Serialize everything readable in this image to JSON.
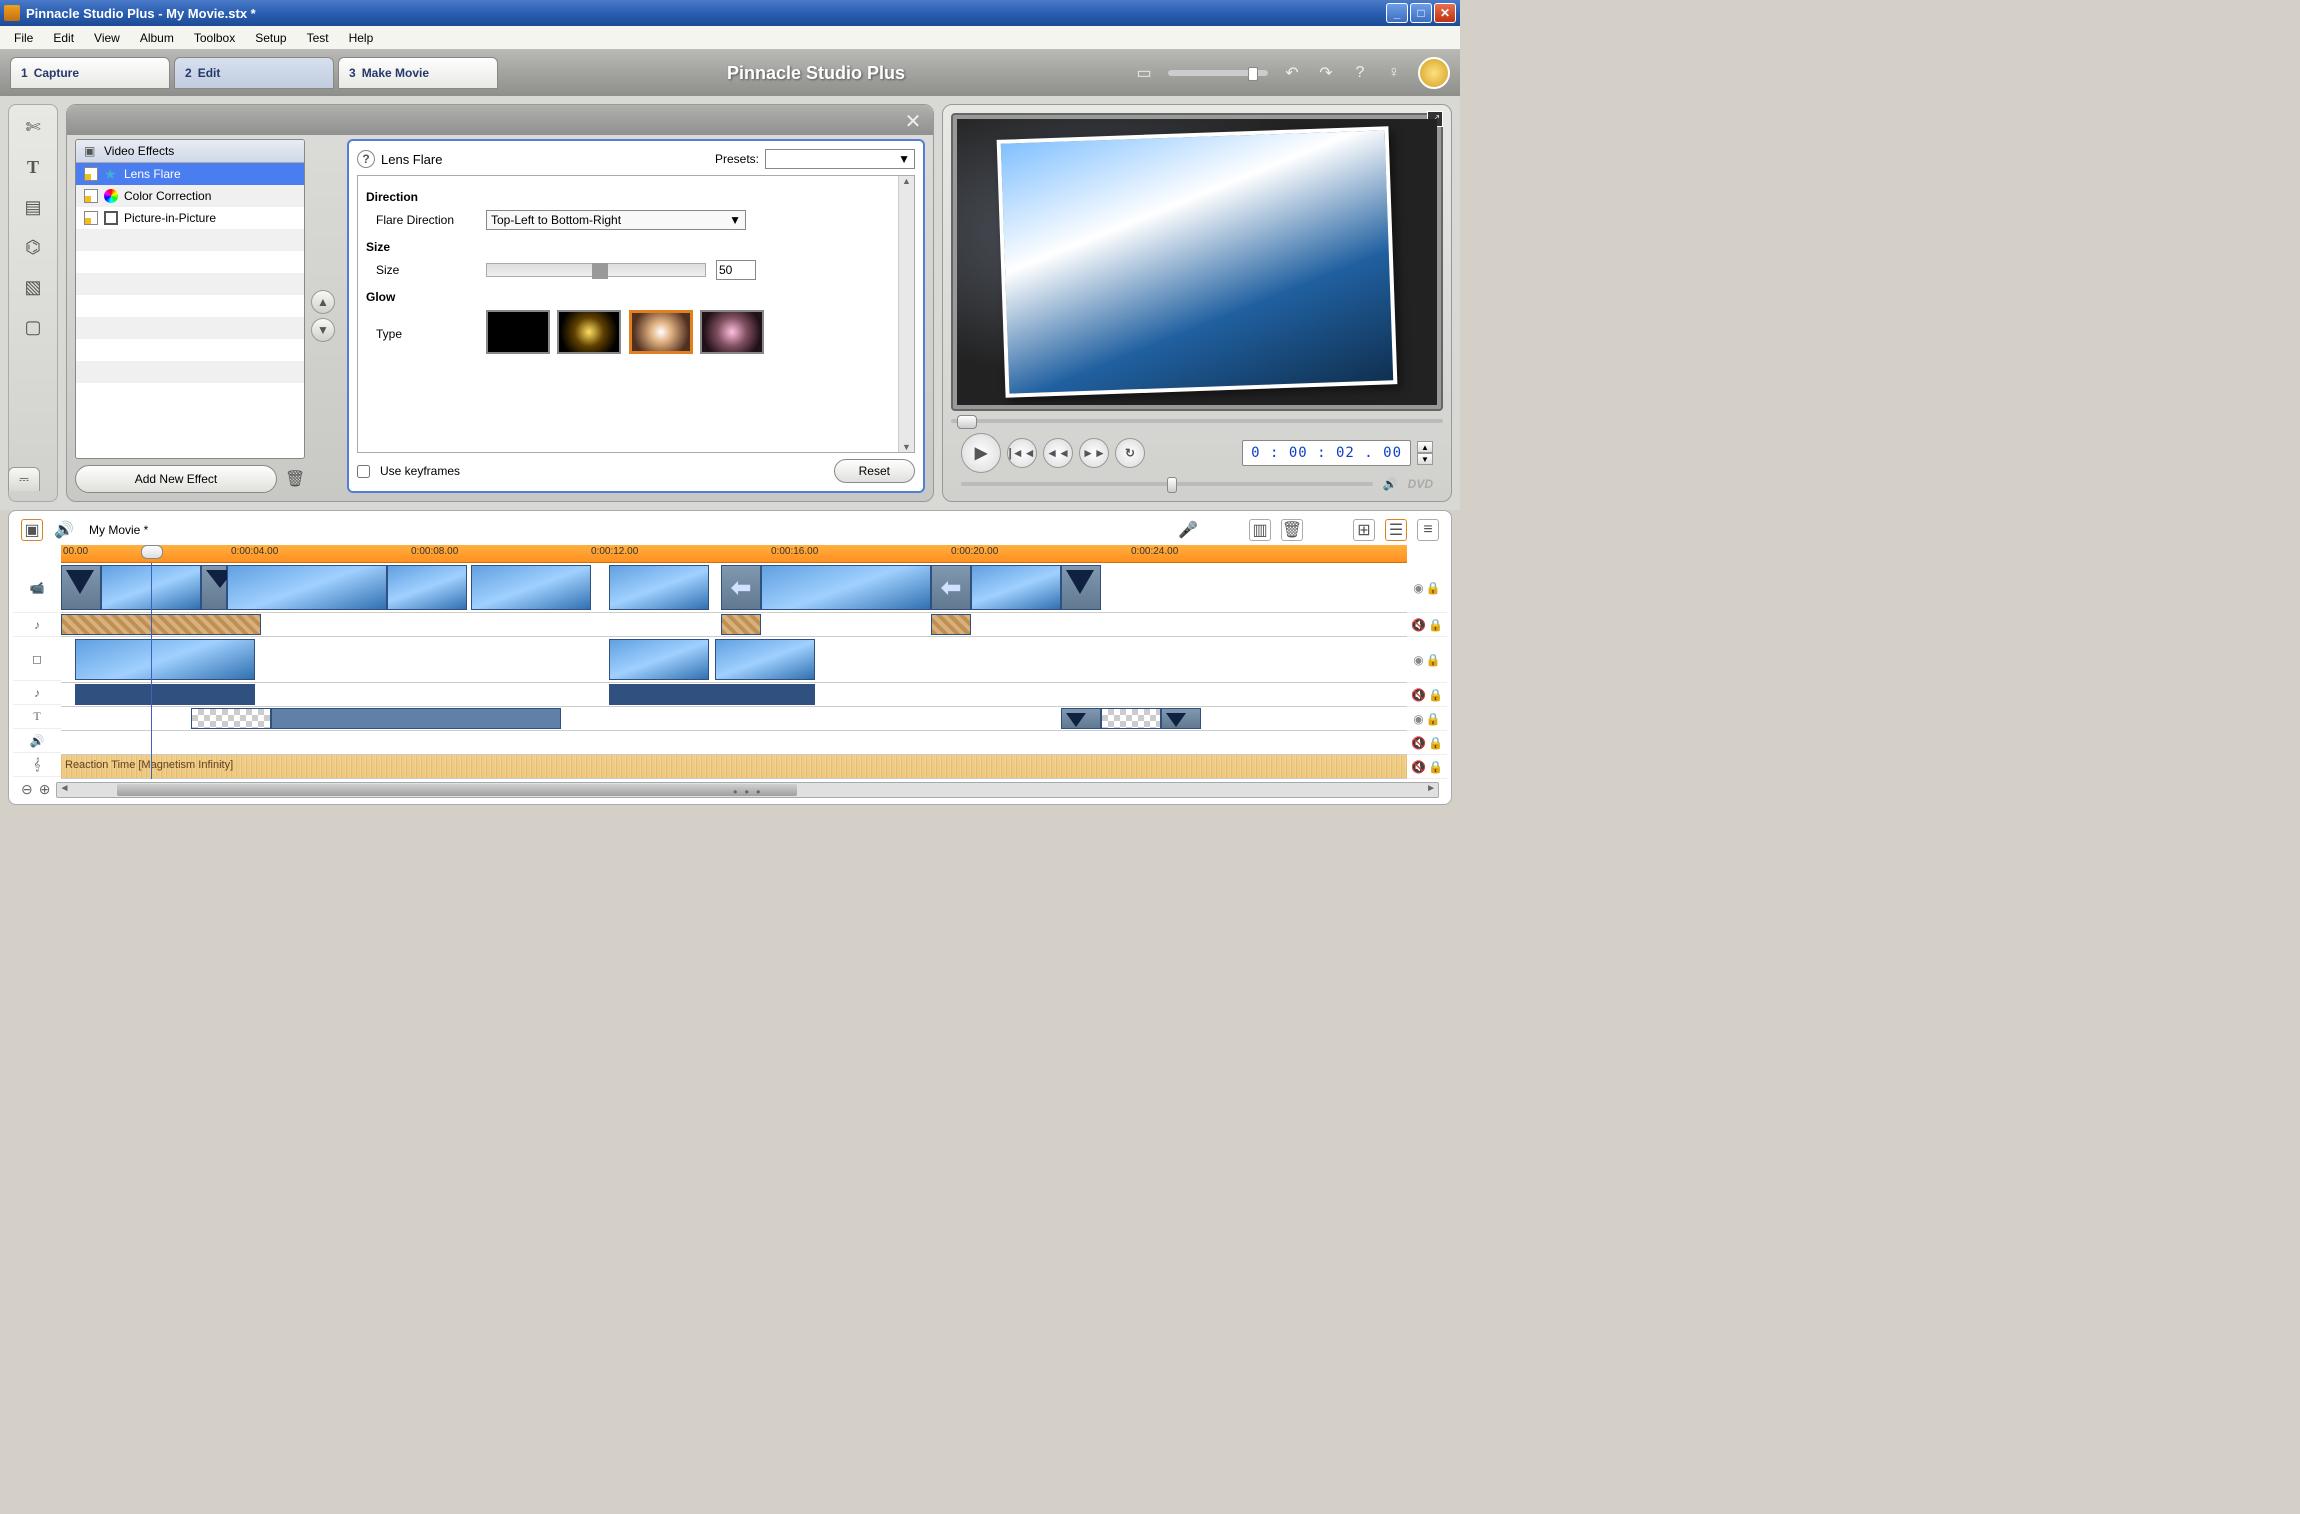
{
  "titlebar": {
    "title": "Pinnacle Studio Plus - My Movie.stx *"
  },
  "menu": [
    "File",
    "Edit",
    "View",
    "Album",
    "Toolbox",
    "Setup",
    "Test",
    "Help"
  ],
  "modes": {
    "capture": {
      "num": "1",
      "label": "Capture"
    },
    "edit": {
      "num": "2",
      "label": "Edit"
    },
    "make": {
      "num": "3",
      "label": "Make Movie"
    }
  },
  "brand": "Pinnacle Studio Plus",
  "effects": {
    "header": "Video Effects",
    "items": {
      "lens": "Lens Flare",
      "color": "Color Correction",
      "pip": "Picture-in-Picture"
    },
    "add_btn": "Add New Effect"
  },
  "props": {
    "title": "Lens Flare",
    "presets_label": "Presets:",
    "section_direction": "Direction",
    "flare_dir_label": "Flare Direction",
    "flare_dir_value": "Top-Left to Bottom-Right",
    "section_size": "Size",
    "size_label": "Size",
    "size_value": "50",
    "section_glow": "Glow",
    "type_label": "Type",
    "use_keyframes": "Use keyframes",
    "reset": "Reset"
  },
  "preview": {
    "timecode": "0 : 00 : 02 . 00"
  },
  "timeline": {
    "project": "My Movie *",
    "ruler": [
      "00.00",
      "0:00:04.00",
      "0:00:08.00",
      "0:00:12.00",
      "0:00:16.00",
      "0:00:20.00",
      "0:00:24.00"
    ],
    "audio_track": "Reaction Time [Magnetism Infinity]"
  }
}
